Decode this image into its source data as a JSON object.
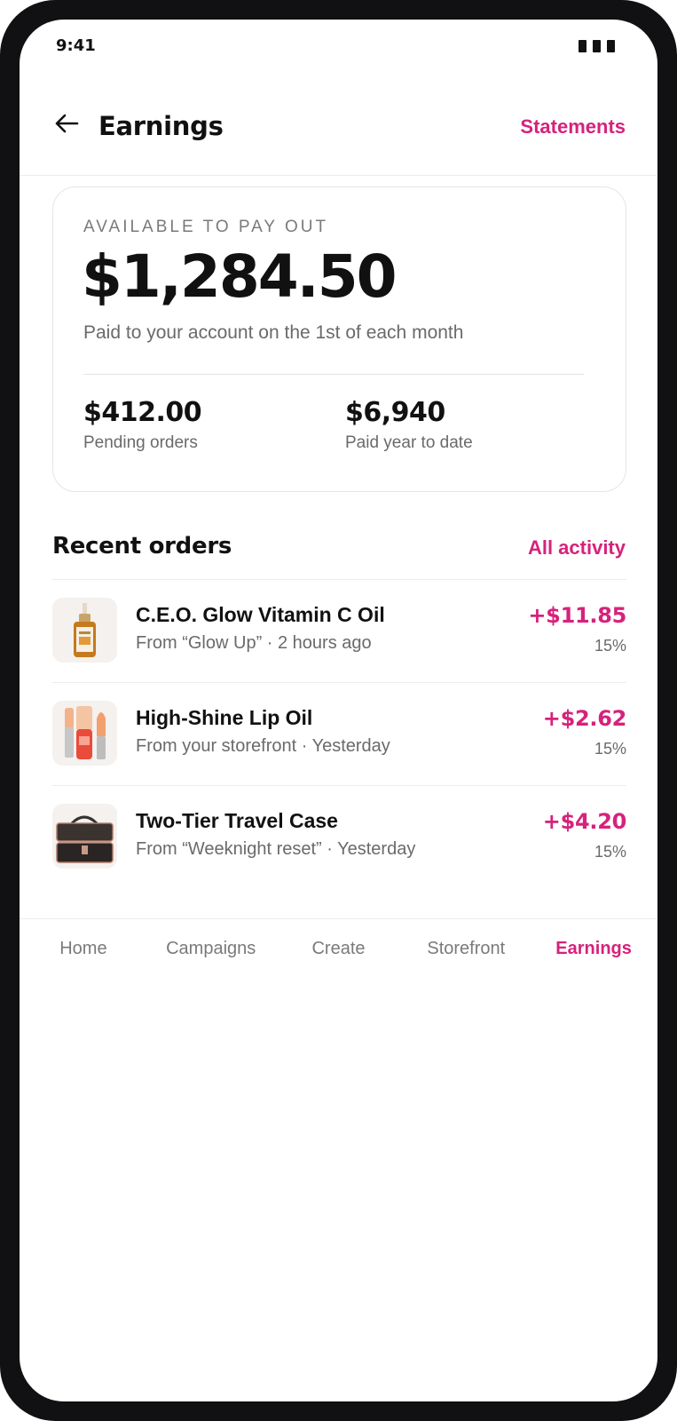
{
  "status_bar": {
    "time": "9:41",
    "battery_icon": "battery-icon"
  },
  "header": {
    "back_icon": "arrow-left-icon",
    "title": "Earnings",
    "statements_label": "Statements"
  },
  "summary": {
    "label": "AVAILABLE TO PAY OUT",
    "amount": "$1,284.50",
    "note": "Paid to your account on the 1st of each month",
    "stats": [
      {
        "value": "$412.00",
        "label": "Pending orders"
      },
      {
        "value": "$6,940",
        "label": "Paid year to date"
      }
    ]
  },
  "recent_orders": {
    "title": "Recent orders",
    "all_activity_label": "All activity",
    "items": [
      {
        "name": "C.E.O. Glow Vitamin C Oil",
        "source": "From “Glow Up” · 2 hours ago",
        "amount": "+$11.85",
        "rate": "15%",
        "thumb_icon": "serum-bottle-icon"
      },
      {
        "name": "High-Shine Lip Oil",
        "source": "From your storefront · Yesterday",
        "amount": "+$2.62",
        "rate": "15%",
        "thumb_icon": "lip-oil-icon"
      },
      {
        "name": "Two-Tier Travel Case",
        "source": "From “Weeknight reset” · Yesterday",
        "amount": "+$4.20",
        "rate": "15%",
        "thumb_icon": "travel-case-icon"
      }
    ]
  },
  "tab_bar": {
    "tabs": [
      {
        "label": "Home",
        "active": false
      },
      {
        "label": "Campaigns",
        "active": false
      },
      {
        "label": "Create",
        "active": false
      },
      {
        "label": "Storefront",
        "active": false
      },
      {
        "label": "Earnings",
        "active": true
      }
    ]
  },
  "colors": {
    "accent": "#d6227c",
    "text_primary": "#111111",
    "text_secondary": "#6a6a6a",
    "border": "#e5e5e5",
    "frame": "#111113"
  }
}
